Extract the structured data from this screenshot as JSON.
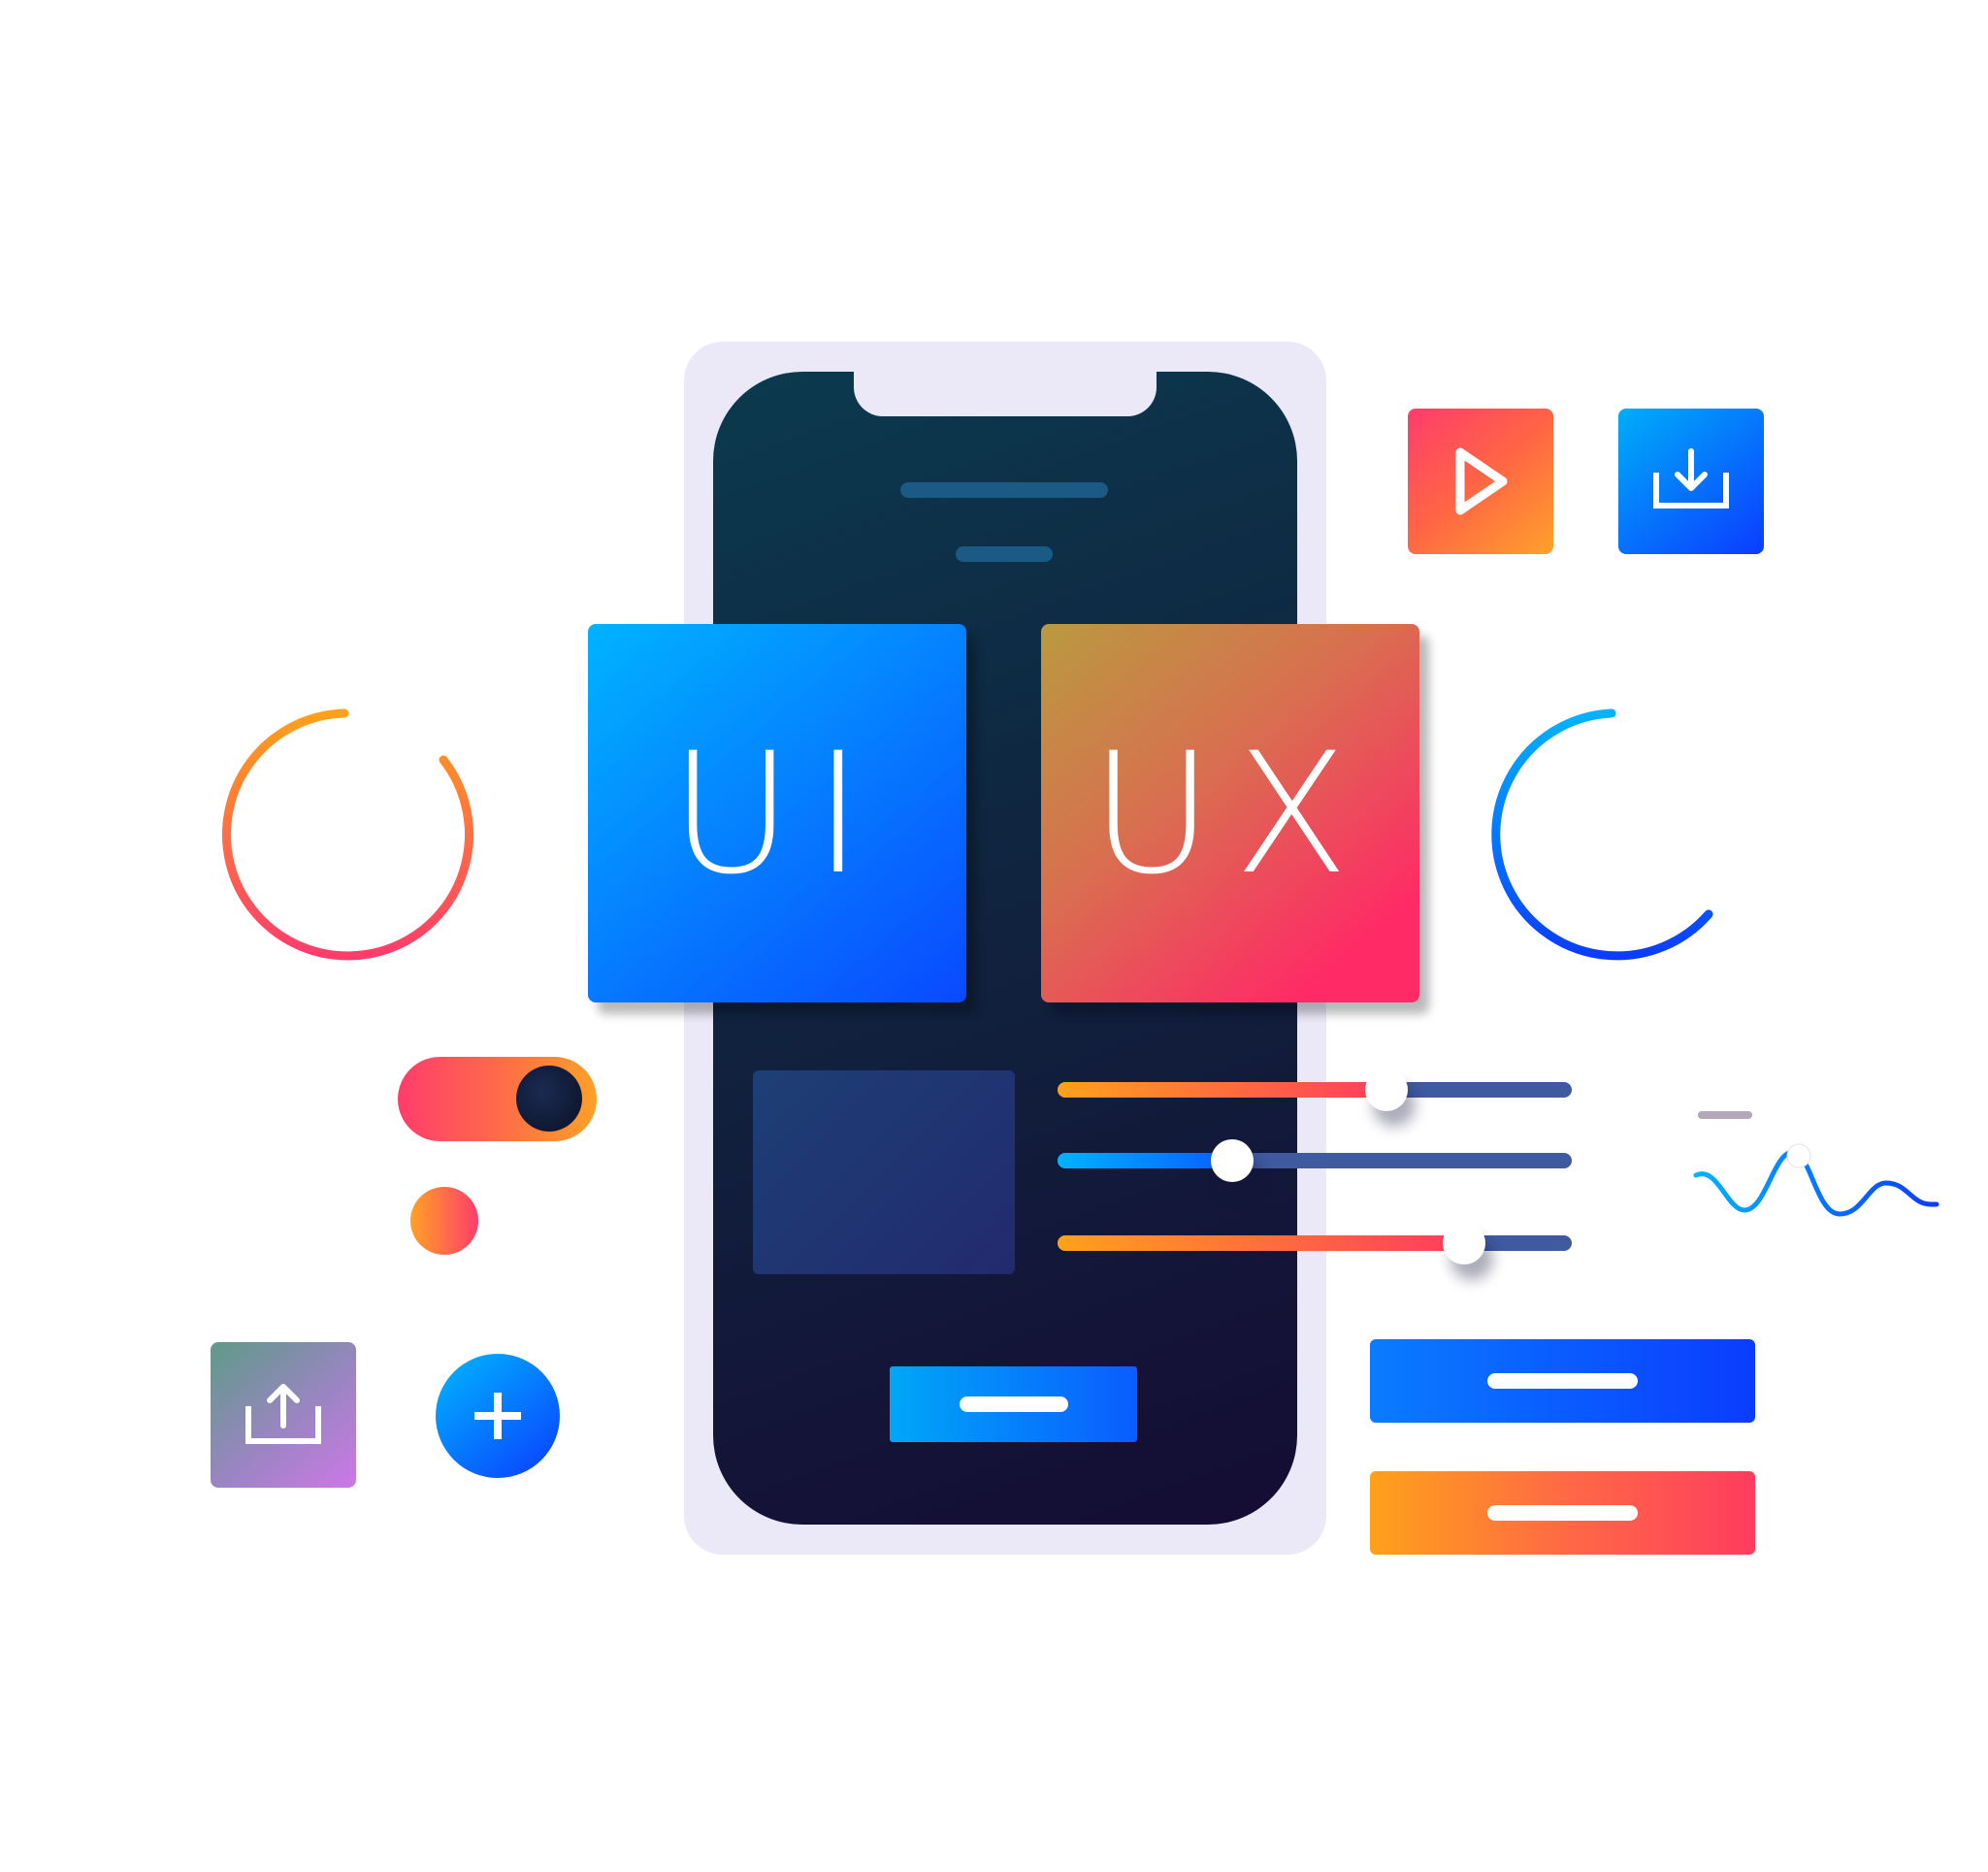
{
  "tiles": {
    "ui_label": "UI",
    "ux_label": "UX"
  },
  "icons": {
    "play": "play-icon",
    "download": "download-icon",
    "upload": "upload-icon",
    "plus": "plus-icon"
  },
  "toggle": {
    "state": "on"
  },
  "sliders": [
    {
      "level": 0.64,
      "fill": [
        "#ffa11a",
        "#ff3c5f"
      ]
    },
    {
      "level": 0.34,
      "fill": [
        "#00b3ff",
        "#0a5cff"
      ]
    },
    {
      "level": 0.79,
      "fill": [
        "#ffa11a",
        "#ff3c5f"
      ]
    }
  ],
  "colors": {
    "phone_frame": "#ebe9f7",
    "screen_dark": "#10243f",
    "accent_blue": "#0a49ff",
    "accent_pink": "#ff2a66",
    "accent_orange": "#ffa126"
  }
}
